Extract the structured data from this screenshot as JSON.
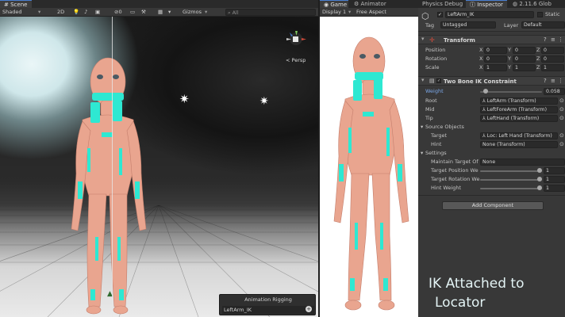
{
  "scene": {
    "tab": "Scene",
    "toolbar": {
      "shading": "Shaded",
      "mode_2d": "2D",
      "gizmos": "Gizmos",
      "search_placeholder": "All"
    },
    "persp_label": "< Persp",
    "overlay": {
      "title": "Animation Rigging",
      "item": "LeftArm_IK",
      "add_symbol": "+"
    }
  },
  "game": {
    "tabs": [
      "Game",
      "Animator"
    ],
    "display": "Display 1",
    "aspect": "Free Aspect"
  },
  "inspector": {
    "tabs": [
      "Physics Debug",
      "Inspector",
      "2.11.6 Glob"
    ],
    "object_name": "LeftArm_IK",
    "static_label": "Static",
    "tag_label": "Tag",
    "tag_value": "Untagged",
    "layer_label": "Layer",
    "layer_value": "Default",
    "transform": {
      "title": "Transform",
      "rows": [
        {
          "label": "Position",
          "x": "0",
          "y": "0",
          "z": "0"
        },
        {
          "label": "Rotation",
          "x": "0",
          "y": "0",
          "z": "0"
        },
        {
          "label": "Scale",
          "x": "1",
          "y": "1",
          "z": "1"
        }
      ],
      "axes": [
        "X",
        "Y",
        "Z"
      ]
    },
    "constraint": {
      "title": "Two Bone IK Constraint",
      "weight_label": "Weight",
      "weight_value": "0.058",
      "weight": 0.058,
      "root_label": "Root",
      "root_value": "LeftArm (Transform)",
      "mid_label": "Mid",
      "mid_value": "LeftForeArm (Transform)",
      "tip_label": "Tip",
      "tip_value": "LeftHand (Transform)",
      "source_objects": "Source Objects",
      "target_label": "Target",
      "target_value": "Loc: Left Hand (Transform)",
      "hint_label": "Hint",
      "hint_value": "None (Transform)",
      "settings": "Settings",
      "maintain_label": "Maintain Target Of",
      "maintain_value": "None",
      "tpw_label": "Target Position We",
      "tpw_value": "1",
      "trw_label": "Target Rotation We",
      "trw_value": "1",
      "hw_label": "Hint Weight",
      "hw_value": "1"
    },
    "add_component": "Add Component"
  },
  "caption": {
    "line1": "IK Attached to",
    "line2": "Locator"
  },
  "colors": {
    "accent": "#4a7fd1",
    "marker": "#2ee8d2",
    "skin": "#e9a58f",
    "panel": "#383838"
  }
}
